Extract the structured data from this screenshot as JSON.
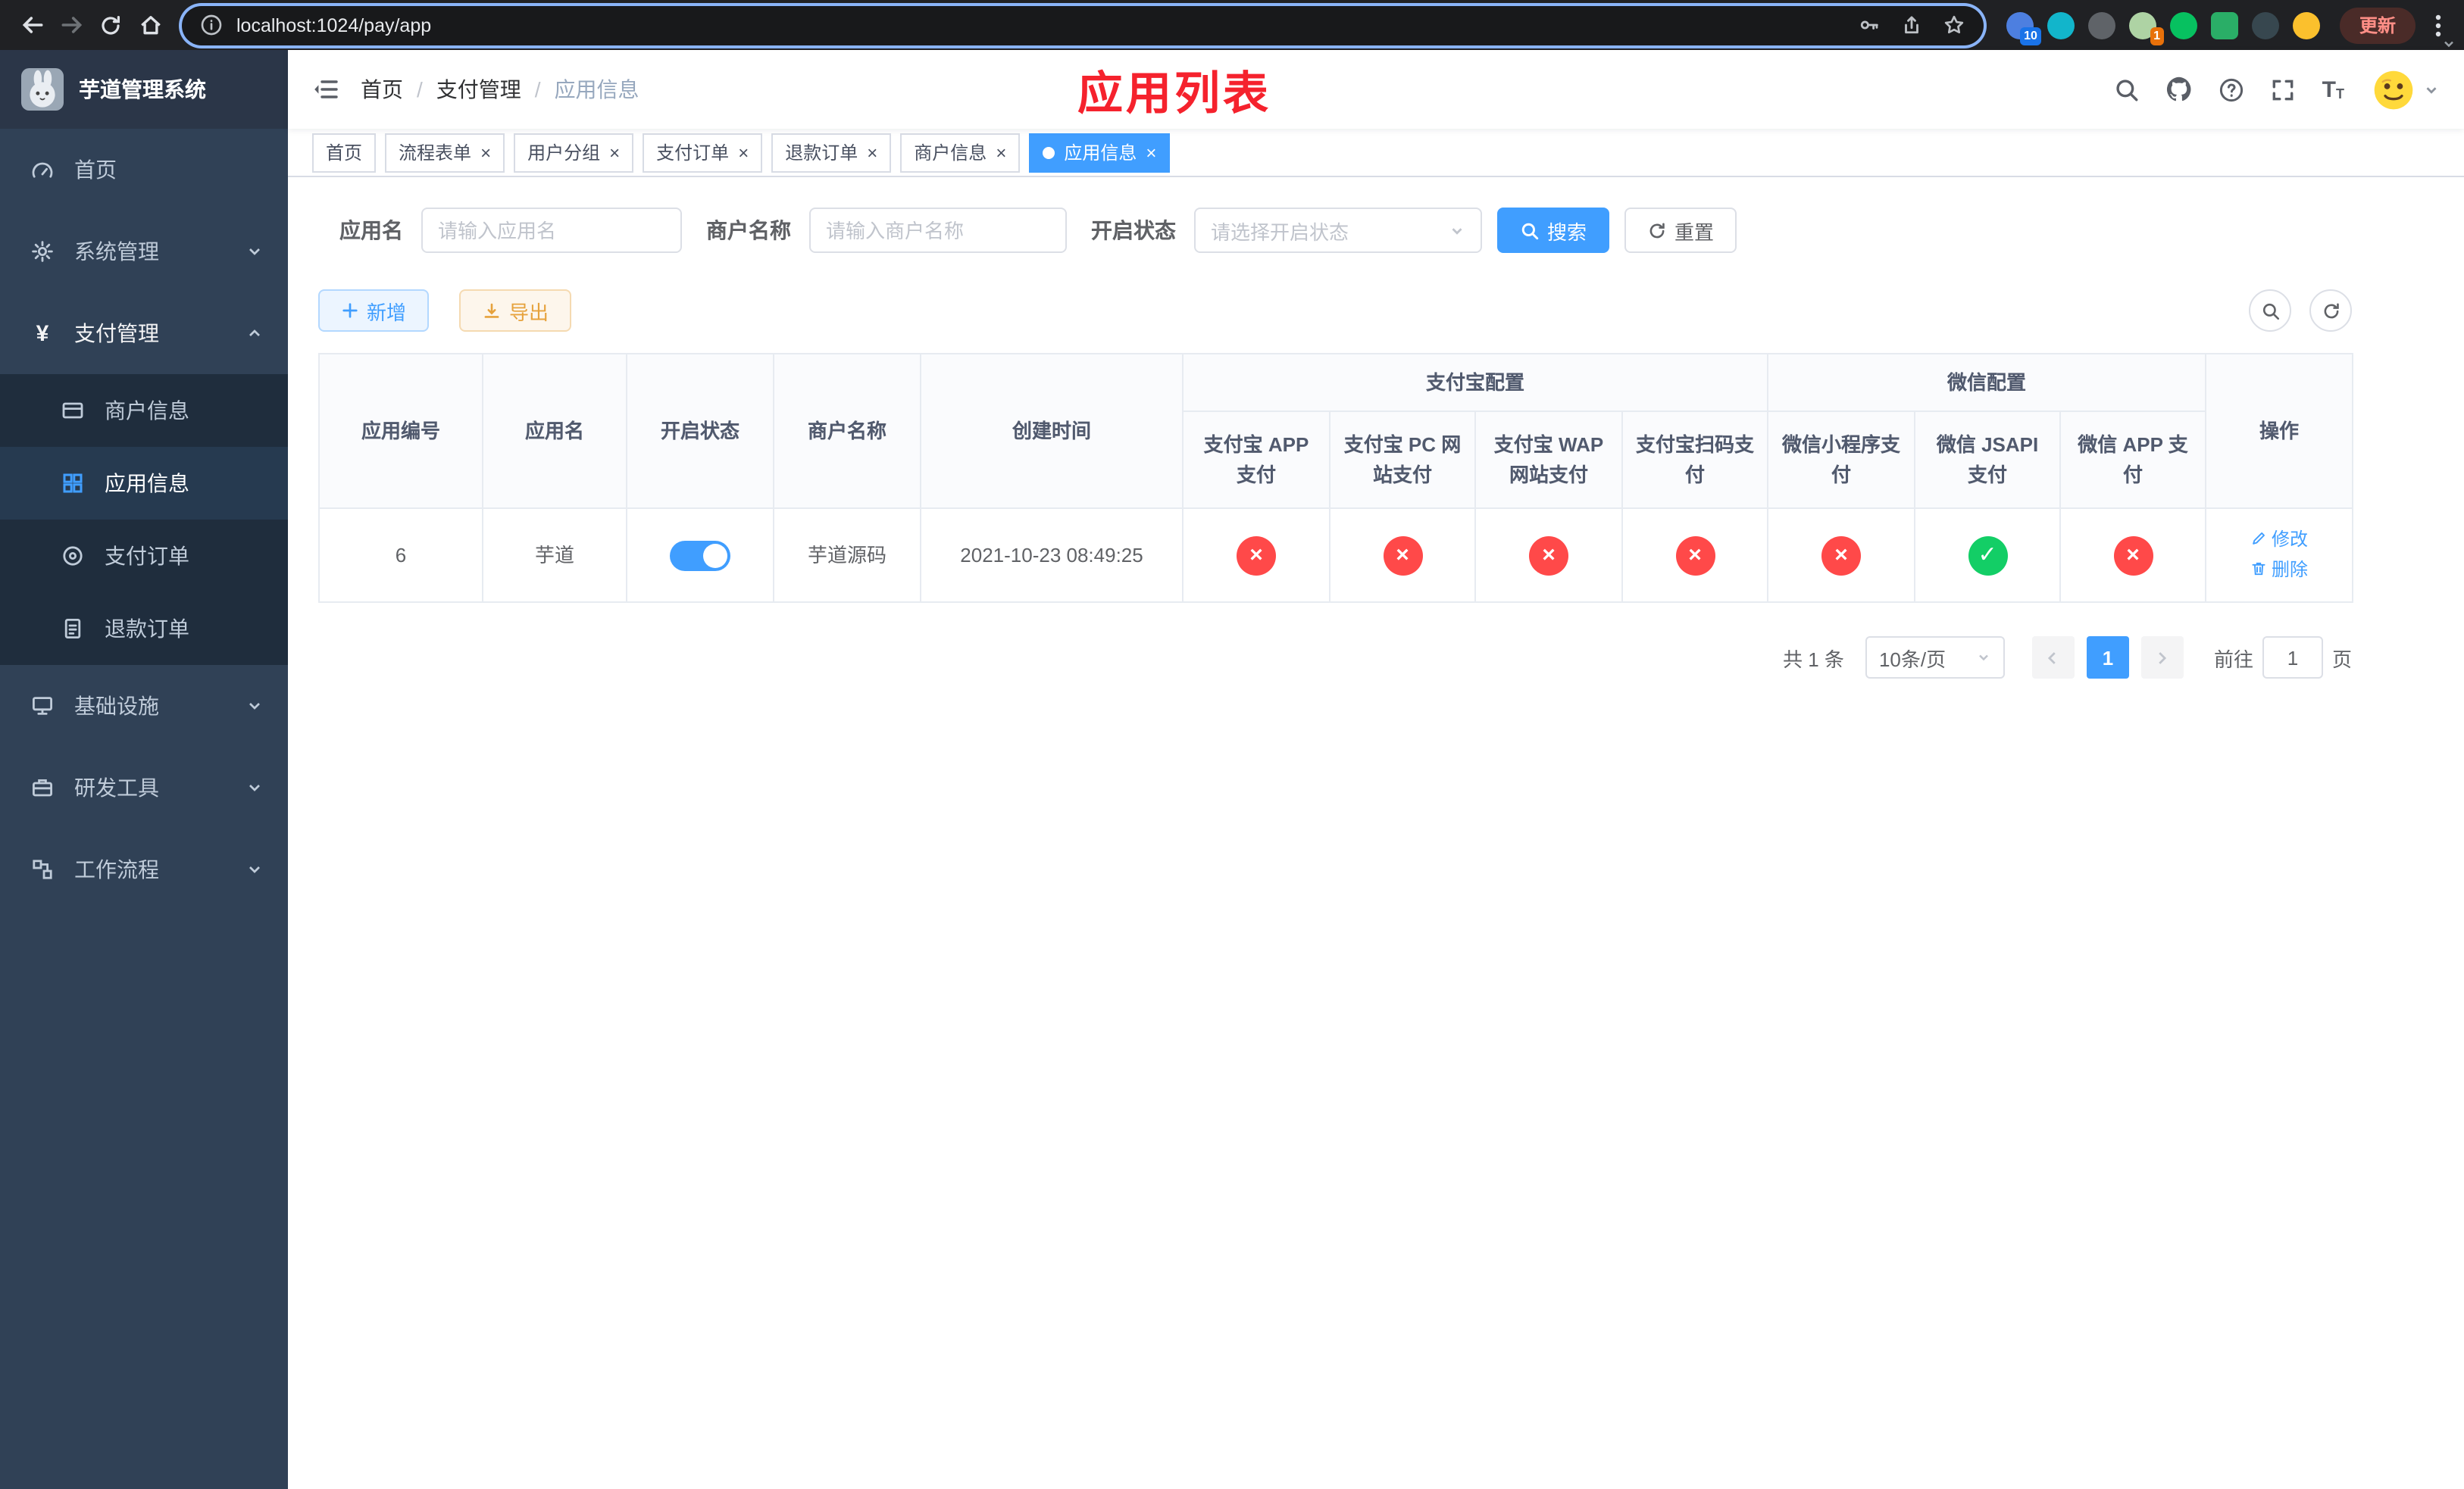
{
  "colors": {
    "primary": "#409eff",
    "success": "#13ce66",
    "danger": "#ff4949",
    "warning": "#e6a23c",
    "title-red": "#f5222d",
    "sidebar-bg": "#304156",
    "submenu-bg": "#1f2d3d"
  },
  "icons": {
    "status_yes": "✓",
    "status_no": "×"
  },
  "browser": {
    "url": "localhost:1024/pay/app",
    "update_label": "更新",
    "ext_badge_blue": "10",
    "ext_badge_orange": "1"
  },
  "sidebar": {
    "title": "芋道管理系统",
    "items": [
      {
        "label": "首页"
      },
      {
        "label": "系统管理"
      },
      {
        "label": "支付管理"
      },
      {
        "label": "基础设施"
      },
      {
        "label": "研发工具"
      },
      {
        "label": "工作流程"
      }
    ],
    "payment_children": [
      {
        "label": "商户信息"
      },
      {
        "label": "应用信息"
      },
      {
        "label": "支付订单"
      },
      {
        "label": "退款订单"
      }
    ],
    "active_item": "应用信息"
  },
  "navbar": {
    "breadcrumb": [
      "首页",
      "支付管理",
      "应用信息"
    ],
    "page_title": "应用列表"
  },
  "tabs": {
    "items": [
      "首页",
      "流程表单",
      "用户分组",
      "支付订单",
      "退款订单",
      "商户信息",
      "应用信息"
    ],
    "active": "应用信息"
  },
  "filters": {
    "app_name_label": "应用名",
    "app_name_placeholder": "请输入应用名",
    "app_name_value": "",
    "merchant_label": "商户名称",
    "merchant_placeholder": "请输入商户名称",
    "merchant_value": "",
    "status_label": "开启状态",
    "status_placeholder": "请选择开启状态",
    "search_button": "搜索",
    "reset_button": "重置"
  },
  "toolbar": {
    "add": "新增",
    "export": "导出"
  },
  "table": {
    "groups": {
      "alipay": "支付宝配置",
      "wechat": "微信配置"
    },
    "columns": [
      "应用编号",
      "应用名",
      "开启状态",
      "商户名称",
      "创建时间",
      "支付宝 APP 支付",
      "支付宝 PC 网站支付",
      "支付宝 WAP 网站支付",
      "支付宝扫码支付",
      "微信小程序支付",
      "微信 JSAPI 支付",
      "微信 APP 支付",
      "操作"
    ],
    "row": {
      "id": "6",
      "name": "芋道",
      "enabled": true,
      "merchant": "芋道源码",
      "created": "2021-10-23 08:49:25",
      "statuses": [
        false,
        false,
        false,
        false,
        false,
        true,
        false
      ],
      "edit": "修改",
      "delete": "删除"
    }
  },
  "pagination": {
    "total": "共 1 条",
    "page_size": "10条/页",
    "page": "1",
    "goto": "前往",
    "goto_value": "1",
    "unit": "页"
  }
}
